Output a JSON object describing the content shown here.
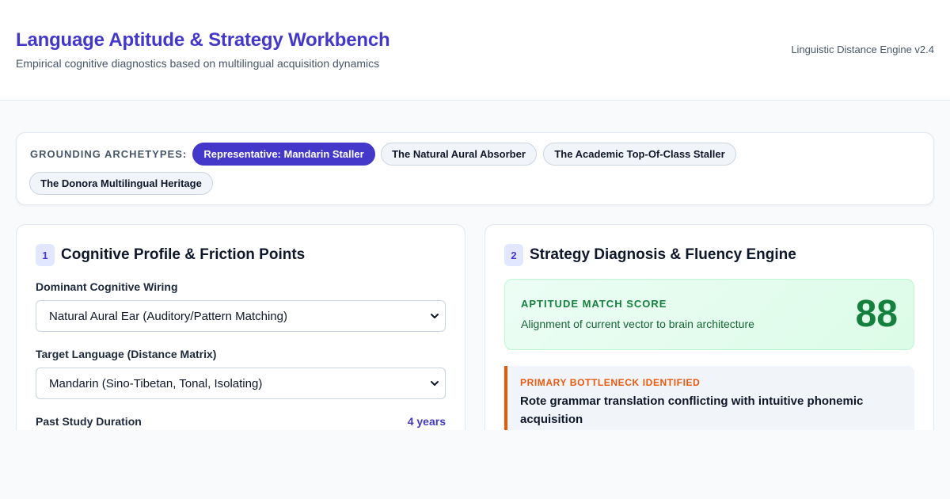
{
  "header": {
    "title": "Language Aptitude & Strategy Workbench",
    "subtitle": "Empirical cognitive diagnostics based on multilingual acquisition dynamics",
    "version": "Linguistic Distance Engine v2.4"
  },
  "archetypes": {
    "label": "GROUNDING ARCHETYPES:",
    "items": [
      {
        "label": "Representative: Mandarin Staller",
        "active": true
      },
      {
        "label": "The Natural Aural Absorber",
        "active": false
      },
      {
        "label": "The Academic Top-Of-Class Staller",
        "active": false
      },
      {
        "label": "The Donora Multilingual Heritage",
        "active": false
      }
    ]
  },
  "profile": {
    "step": "1",
    "title": "Cognitive Profile & Friction Points",
    "wiring_label": "Dominant Cognitive Wiring",
    "wiring_value": "Natural Aural Ear (Auditory/Pattern Matching)",
    "target_label": "Target Language (Distance Matrix)",
    "target_value": "Mandarin (Sino-Tibetan, Tonal, Isolating)",
    "duration_label": "Past Study Duration",
    "duration_value": "4 years"
  },
  "strategy": {
    "step": "2",
    "title": "Strategy Diagnosis & Fluency Engine",
    "score_label": "APTITUDE MATCH SCORE",
    "score_desc": "Alignment of current vector to brain architecture",
    "score_value": "88",
    "bottleneck_label": "PRIMARY BOTTLENECK IDENTIFIED",
    "bottleneck_text": "Rote grammar translation conflicting with intuitive phonemic acquisition"
  },
  "colors": {
    "accent": "#4338ca",
    "success": "#15803d",
    "warning": "#ea580c"
  }
}
